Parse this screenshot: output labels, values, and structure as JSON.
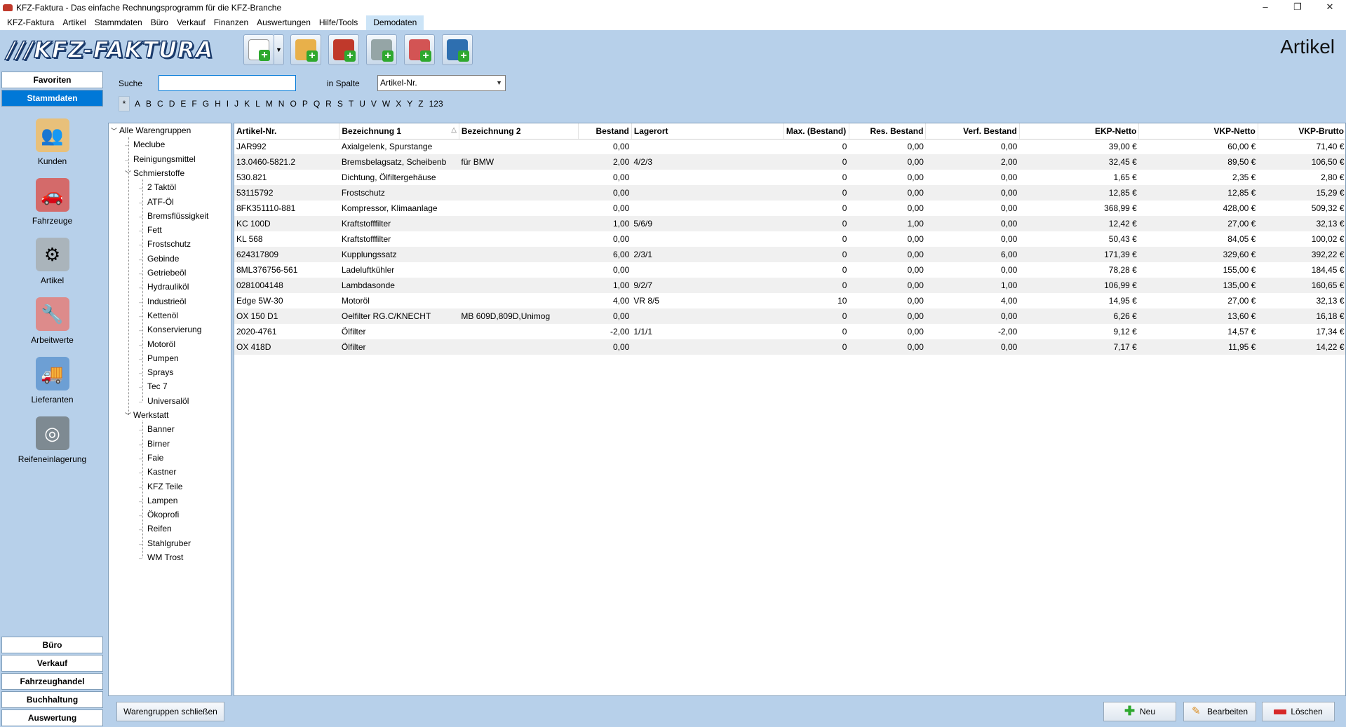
{
  "window": {
    "title": "KFZ-Faktura - Das einfache Rechnungsprogramm für die KFZ-Branche",
    "controls": {
      "minimize": "–",
      "maximize": "❐",
      "close": "✕"
    }
  },
  "menu": [
    "KFZ-Faktura",
    "Artikel",
    "Stammdaten",
    "Büro",
    "Verkauf",
    "Finanzen",
    "Auswertungen",
    "Hilfe/Tools",
    "Demodaten"
  ],
  "logo": {
    "text": "///KFZ-FAKTURA"
  },
  "toolbar": {
    "heading": "Artikel",
    "buttons": [
      {
        "icon": "new-document-icon",
        "accent": "#ffffff"
      },
      {
        "icon": "add-customer-icon",
        "accent": "#e8b04a"
      },
      {
        "icon": "add-vehicle-icon",
        "accent": "#c0392b"
      },
      {
        "icon": "add-article-icon",
        "accent": "#7f8c8d"
      },
      {
        "icon": "add-work-icon",
        "accent": "#c0392b"
      },
      {
        "icon": "add-supplier-icon",
        "accent": "#2e6fb0"
      }
    ],
    "dropdown_glyph": "▼"
  },
  "sidebar": {
    "favoriten": "Favoriten",
    "stammdaten": "Stammdaten",
    "items": [
      {
        "label": "Kunden",
        "icon": "customers-icon",
        "glyph": "👥"
      },
      {
        "label": "Fahrzeuge",
        "icon": "vehicles-icon",
        "glyph": "🚗"
      },
      {
        "label": "Artikel",
        "icon": "article-icon",
        "glyph": "⚙"
      },
      {
        "label": "Arbeitwerte",
        "icon": "tools-icon",
        "glyph": "🔧"
      },
      {
        "label": "Lieferanten",
        "icon": "truck-icon",
        "glyph": "🚚"
      },
      {
        "label": "Reifeneinlagerung",
        "icon": "tire-icon",
        "glyph": "◎"
      }
    ],
    "bottom_tabs": [
      "Büro",
      "Verkauf",
      "Fahrzeughandel",
      "Buchhaltung",
      "Auswertung"
    ]
  },
  "search": {
    "label": "Suche",
    "value": "",
    "column_label": "in Spalte",
    "column_value": "Artikel-Nr.",
    "alphabet": [
      "*",
      "A",
      "B",
      "C",
      "D",
      "E",
      "F",
      "G",
      "H",
      "I",
      "J",
      "K",
      "L",
      "M",
      "N",
      "O",
      "P",
      "Q",
      "R",
      "S",
      "T",
      "U",
      "V",
      "W",
      "X",
      "Y",
      "Z",
      "123"
    ]
  },
  "tree": {
    "root": "Alle Warengruppen",
    "nodes": [
      {
        "label": "Meclube",
        "level": 1
      },
      {
        "label": "Reinigungsmittel",
        "level": 1
      },
      {
        "label": "Schmierstoffe",
        "level": 1,
        "expanded": true
      },
      {
        "label": "2 Taktöl",
        "level": 2
      },
      {
        "label": "ATF-Öl",
        "level": 2
      },
      {
        "label": "Bremsflüssigkeit",
        "level": 2
      },
      {
        "label": "Fett",
        "level": 2
      },
      {
        "label": "Frostschutz",
        "level": 2
      },
      {
        "label": "Gebinde",
        "level": 2
      },
      {
        "label": "Getriebeöl",
        "level": 2
      },
      {
        "label": "Hydrauliköl",
        "level": 2
      },
      {
        "label": "Industrieöl",
        "level": 2
      },
      {
        "label": "Kettenöl",
        "level": 2
      },
      {
        "label": "Konservierung",
        "level": 2
      },
      {
        "label": "Motoröl",
        "level": 2
      },
      {
        "label": "Pumpen",
        "level": 2
      },
      {
        "label": "Sprays",
        "level": 2
      },
      {
        "label": "Tec 7",
        "level": 2
      },
      {
        "label": "Universalöl",
        "level": 2
      },
      {
        "label": "Werkstatt",
        "level": 1,
        "expanded": true
      },
      {
        "label": "Banner",
        "level": 2
      },
      {
        "label": "Birner",
        "level": 2
      },
      {
        "label": "Faie",
        "level": 2
      },
      {
        "label": "Kastner",
        "level": 2
      },
      {
        "label": "KFZ Teile",
        "level": 2
      },
      {
        "label": "Lampen",
        "level": 2
      },
      {
        "label": "Ökoprofi",
        "level": 2
      },
      {
        "label": "Reifen",
        "level": 2
      },
      {
        "label": "Stahlgruber",
        "level": 2
      },
      {
        "label": "WM Trost",
        "level": 2
      }
    ]
  },
  "table": {
    "sort_glyph": "△",
    "columns": [
      "Artikel-Nr.",
      "Bezeichnung 1",
      "Bezeichnung 2",
      "Bestand",
      "Lagerort",
      "Max. (Bestand)",
      "Res. Bestand",
      "Verf. Bestand",
      "EKP-Netto",
      "VKP-Netto",
      "VKP-Brutto"
    ],
    "rows": [
      [
        "JAR992",
        "Axialgelenk, Spurstange",
        "",
        "0,00",
        "",
        "0",
        "0,00",
        "0,00",
        "39,00 €",
        "60,00 €",
        "71,40 €"
      ],
      [
        "13.0460-5821.2",
        "Bremsbelagsatz, Scheibenb",
        "für BMW",
        "2,00",
        "4/2/3",
        "0",
        "0,00",
        "2,00",
        "32,45 €",
        "89,50 €",
        "106,50 €"
      ],
      [
        "530.821",
        "Dichtung, Ölfiltergehäuse",
        "",
        "0,00",
        "",
        "0",
        "0,00",
        "0,00",
        "1,65 €",
        "2,35 €",
        "2,80 €"
      ],
      [
        "53115792",
        "Frostschutz",
        "",
        "0,00",
        "",
        "0",
        "0,00",
        "0,00",
        "12,85 €",
        "12,85 €",
        "15,29 €"
      ],
      [
        "8FK351110-881",
        "Kompressor, Klimaanlage",
        "",
        "0,00",
        "",
        "0",
        "0,00",
        "0,00",
        "368,99 €",
        "428,00 €",
        "509,32 €"
      ],
      [
        "KC 100D",
        "Kraftstofffilter",
        "",
        "1,00",
        "5/6/9",
        "0",
        "1,00",
        "0,00",
        "12,42 €",
        "27,00 €",
        "32,13 €"
      ],
      [
        "KL 568",
        "Kraftstofffilter",
        "",
        "0,00",
        "",
        "0",
        "0,00",
        "0,00",
        "50,43 €",
        "84,05 €",
        "100,02 €"
      ],
      [
        "624317809",
        "Kupplungssatz",
        "",
        "6,00",
        "2/3/1",
        "0",
        "0,00",
        "6,00",
        "171,39 €",
        "329,60 €",
        "392,22 €"
      ],
      [
        "8ML376756-561",
        "Ladeluftkühler",
        "",
        "0,00",
        "",
        "0",
        "0,00",
        "0,00",
        "78,28 €",
        "155,00 €",
        "184,45 €"
      ],
      [
        "0281004148",
        "Lambdasonde",
        "",
        "1,00",
        "9/2/7",
        "0",
        "0,00",
        "1,00",
        "106,99 €",
        "135,00 €",
        "160,65 €"
      ],
      [
        "Edge 5W-30",
        "Motoröl",
        "",
        "4,00",
        "VR 8/5",
        "10",
        "0,00",
        "4,00",
        "14,95 €",
        "27,00 €",
        "32,13 €"
      ],
      [
        "OX 150 D1",
        "Oelfilter RG.C/KNECHT",
        "MB 609D,809D,Unimog",
        "0,00",
        "",
        "0",
        "0,00",
        "0,00",
        "6,26 €",
        "13,60 €",
        "16,18 €"
      ],
      [
        "2020-4761",
        "Ölfilter",
        "",
        "-2,00",
        "1/1/1",
        "0",
        "0,00",
        "-2,00",
        "9,12 €",
        "14,57 €",
        "17,34 €"
      ],
      [
        "OX 418D",
        "Ölfilter",
        "",
        "0,00",
        "",
        "0",
        "0,00",
        "0,00",
        "7,17 €",
        "11,95 €",
        "14,22 €"
      ]
    ]
  },
  "bottom": {
    "close_groups": "Warengruppen schließen",
    "new": "Neu",
    "edit": "Bearbeiten",
    "delete": "Löschen"
  }
}
